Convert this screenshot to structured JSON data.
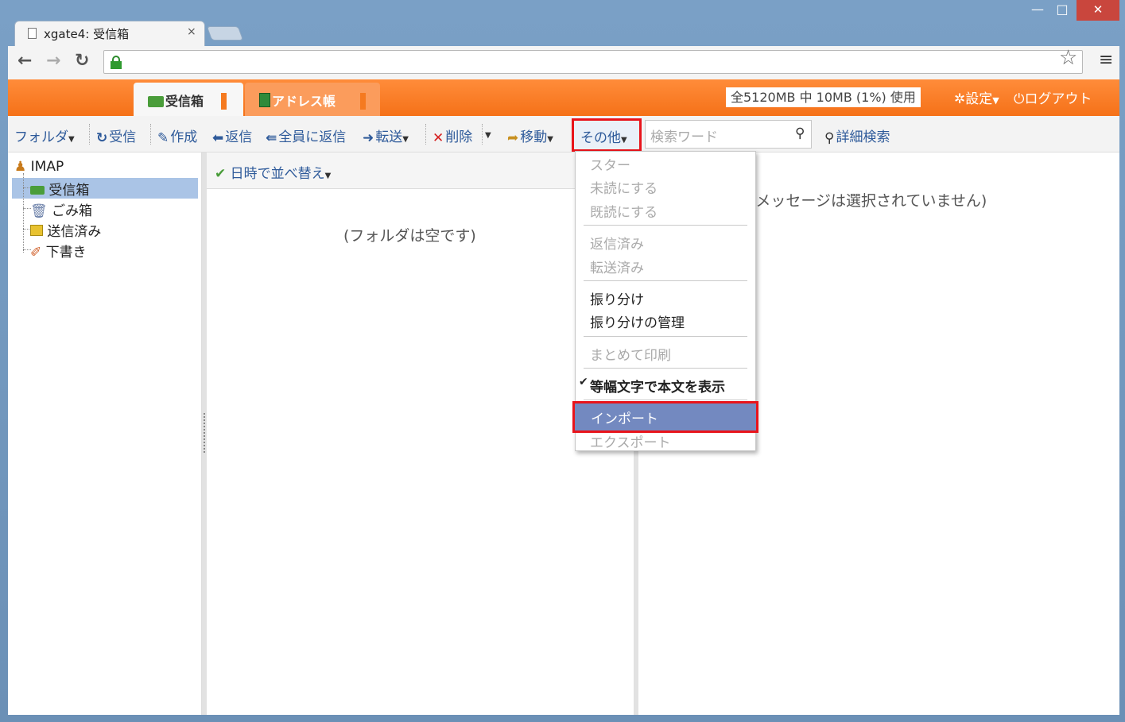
{
  "browser": {
    "tab_title": "xgate4: 受信箱",
    "tab_close": "×",
    "win_min": "—",
    "win_max": "□",
    "win_close": "✕"
  },
  "app": {
    "tabs": [
      {
        "label": "受信箱"
      },
      {
        "label": "アドレス帳"
      }
    ],
    "quota": "全5120MB 中 10MB (1%) 使用",
    "settings": "設定",
    "logout": "ログアウト"
  },
  "toolbar": {
    "folder": "フォルダ",
    "receive": "受信",
    "compose": "作成",
    "reply": "返信",
    "reply_all": "全員に返信",
    "forward": "転送",
    "delete": "削除",
    "move": "移動",
    "other": "その他",
    "search_placeholder": "検索ワード",
    "advanced_search": "詳細検索"
  },
  "folders": {
    "account": "IMAP",
    "items": [
      {
        "label": "受信箱"
      },
      {
        "label": "ごみ箱"
      },
      {
        "label": "送信済み"
      },
      {
        "label": "下書き"
      }
    ]
  },
  "list": {
    "sort": "日時で並べ替え",
    "empty": "(フォルダは空です)"
  },
  "preview": {
    "empty": "(メッセージは選択されていません)"
  },
  "menu": {
    "star": "スター",
    "mark_unread": "未読にする",
    "mark_read": "既読にする",
    "replied": "返信済み",
    "forwarded": "転送済み",
    "filter": "振り分け",
    "filter_manage": "振り分けの管理",
    "print": "まとめて印刷",
    "monospace": "等幅文字で本文を表示",
    "import": "インポート",
    "export": "エクスポート"
  },
  "colors": {
    "accent": "#f57118",
    "link": "#2e5a9a",
    "highlight": "#e8141b",
    "selected": "#7389c0"
  }
}
